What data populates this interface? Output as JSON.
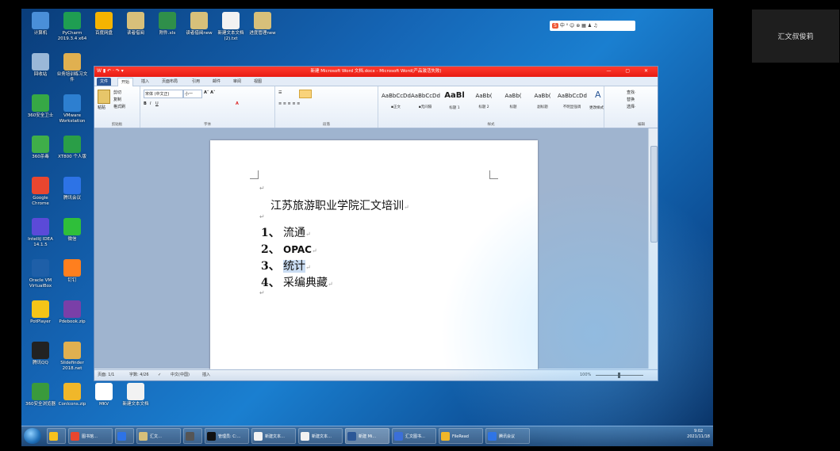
{
  "participant": {
    "name": "汇文叔俊莉"
  },
  "desktop_icons": [
    {
      "label": "计算机",
      "color": "#4a8fd8"
    },
    {
      "label": "PyCharm 2019.3.4 x64",
      "color": "#1f9e52"
    },
    {
      "label": "百度网盘",
      "color": "#f5b400"
    },
    {
      "label": "读者借阅",
      "color": "#d7c07a"
    },
    {
      "label": "附件.xls",
      "color": "#2f8f4a"
    },
    {
      "label": "读者借阅new",
      "color": "#d7c07a"
    },
    {
      "label": "新建文本文档(2).txt",
      "color": "#f2f2f2"
    },
    {
      "label": "进度管理new",
      "color": "#d7c07a"
    },
    {
      "label": "回收站",
      "color": "#9ab8d8"
    },
    {
      "label": "业务培训练习文件",
      "color": "#e0b050"
    },
    {
      "label": "360安全卫士",
      "color": "#36a845"
    },
    {
      "label": "VMware Workstation",
      "color": "#2d7fd0"
    },
    {
      "label": "360杀毒",
      "color": "#3fae49"
    },
    {
      "label": "XT800 个人版",
      "color": "#2a9e47"
    },
    {
      "label": "Google Chrome",
      "color": "#e9462f"
    },
    {
      "label": "腾讯会议",
      "color": "#2d73e6"
    },
    {
      "label": "IntelliJ IDEA 14.1.5",
      "color": "#5b4ad8"
    },
    {
      "label": "微信",
      "color": "#2fbf3a"
    },
    {
      "label": "Oracle VM VirtualBox",
      "color": "#1e5fa8"
    },
    {
      "label": "钉钉",
      "color": "#ff7f1e"
    },
    {
      "label": "PotPlayer",
      "color": "#f5c518"
    },
    {
      "label": "Pdebook.zip",
      "color": "#7a3fa8"
    },
    {
      "label": "腾讯QQ",
      "color": "#222222"
    },
    {
      "label": "Slidefinder 2018.net",
      "color": "#e0b050"
    },
    {
      "label": "360安全浏览器",
      "color": "#3a9a3c"
    },
    {
      "label": "ConIcons.zip",
      "color": "#f0b72a"
    },
    {
      "label": "MKV",
      "color": "#ffffff"
    },
    {
      "label": "新建文本文档",
      "color": "#f2f2f2"
    }
  ],
  "ime": {
    "label": "中 ⁰ ☺ ⊕ ▦ ♟ ♫"
  },
  "word": {
    "title": "新建 Microsoft Word 文档.docx - Microsoft Word(产品激活失败)",
    "quick_access": "W ▮ ↶ · ↷ ▾",
    "window_controls": "— ▢ ✕",
    "tabs": [
      "文件",
      "开始",
      "插入",
      "页面布局",
      "引用",
      "邮件",
      "审阅",
      "视图"
    ],
    "clipboard": {
      "paste": "粘贴",
      "cut": "剪切",
      "copy": "复制",
      "format_painter": "格式刷",
      "label": "剪贴板"
    },
    "font": {
      "name": "宋体 (中文正)",
      "size": "小一",
      "label": "字体"
    },
    "paragraph": {
      "label": "段落"
    },
    "styles": [
      {
        "preview": "AaBbCcDd",
        "name": "▪正文"
      },
      {
        "preview": "AaBbCcDd",
        "name": "▪无间隔"
      },
      {
        "preview": "AaBl",
        "name": "标题 1"
      },
      {
        "preview": "AaBb(",
        "name": "标题 2"
      },
      {
        "preview": "AaBb(",
        "name": "标题"
      },
      {
        "preview": "AaBb(",
        "name": "副标题"
      },
      {
        "preview": "AaBbCcDd",
        "name": "不明显强调"
      }
    ],
    "styles_label": "样式",
    "change_styles": "更改样式",
    "editing": {
      "find": "查找·",
      "replace": "替换",
      "select": "选择·",
      "label": "编辑"
    },
    "document": {
      "title": "江苏旅游职业学院汇文培训",
      "items": [
        {
          "num": "1、",
          "text": "流通"
        },
        {
          "num": "2、",
          "text": "OPAC"
        },
        {
          "num": "3、",
          "text": "统计"
        },
        {
          "num": "4、",
          "text": "采编典藏"
        }
      ]
    },
    "status": {
      "page": "页面: 1/1",
      "words": "字数: 4/26",
      "language": "中文(中国)",
      "mode": "插入",
      "zoom": "100%"
    }
  },
  "taskbar": {
    "items": [
      {
        "label": "",
        "color": "#f7c11e"
      },
      {
        "label": "图书馆…",
        "color": "#e9462f"
      },
      {
        "label": "",
        "color": "#2d73e6"
      },
      {
        "label": "汇文…",
        "color": "#d7c07a"
      },
      {
        "label": "",
        "color": "#555555"
      },
      {
        "label": "管理员: C:…",
        "color": "#111111"
      },
      {
        "label": "新建文本…",
        "color": "#f2f2f2"
      },
      {
        "label": "新建文本…",
        "color": "#f2f2f2"
      },
      {
        "label": "新建 Mi…",
        "color": "#2b5797"
      },
      {
        "label": "汇文图书…",
        "color": "#3b6fd8"
      },
      {
        "label": "FileRead",
        "color": "#f0b72a"
      },
      {
        "label": "腾讯会议",
        "color": "#2d73e6"
      }
    ],
    "time": "9:02",
    "date": "2021/11/18"
  }
}
